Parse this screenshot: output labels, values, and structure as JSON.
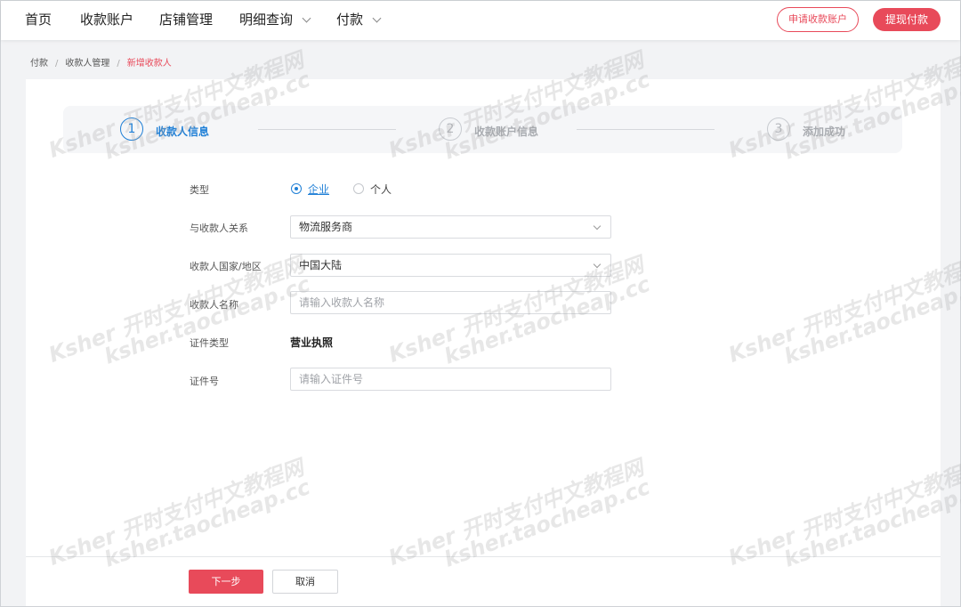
{
  "nav": {
    "items": [
      {
        "label": "首页",
        "dropdown": false
      },
      {
        "label": "收款账户",
        "dropdown": false
      },
      {
        "label": "店铺管理",
        "dropdown": false
      },
      {
        "label": "明细查询",
        "dropdown": true
      },
      {
        "label": "付款",
        "dropdown": true
      }
    ],
    "apply_account_label": "申请收款账户",
    "withdraw_label": "提现付款"
  },
  "breadcrumb": [
    "付款",
    "收款人管理",
    "新增收款人"
  ],
  "steps": [
    {
      "number": "1",
      "label": "收款人信息",
      "active": true
    },
    {
      "number": "2",
      "label": "收款账户信息",
      "active": false
    },
    {
      "number": "3",
      "label": "添加成功",
      "active": false
    }
  ],
  "form": {
    "type": {
      "label": "类型",
      "options": [
        {
          "label": "企业",
          "checked": true
        },
        {
          "label": "个人",
          "checked": false
        }
      ]
    },
    "relation": {
      "label": "与收款人关系",
      "value": "物流服务商"
    },
    "country": {
      "label": "收款人国家/地区",
      "value": "中国大陆"
    },
    "name": {
      "label": "收款人名称",
      "placeholder": "请输入收款人名称"
    },
    "cert_type": {
      "label": "证件类型",
      "value": "营业执照"
    },
    "cert_no": {
      "label": "证件号",
      "placeholder": "请输入证件号"
    }
  },
  "footer": {
    "next_label": "下一步",
    "cancel_label": "取消"
  },
  "watermark": {
    "line1": "Ksher 开时支付中文教程网",
    "line2": "ksher.taocheap.cc"
  },
  "colors": {
    "brand_red": "#e84a5a",
    "active_blue": "#1f7fd6"
  }
}
